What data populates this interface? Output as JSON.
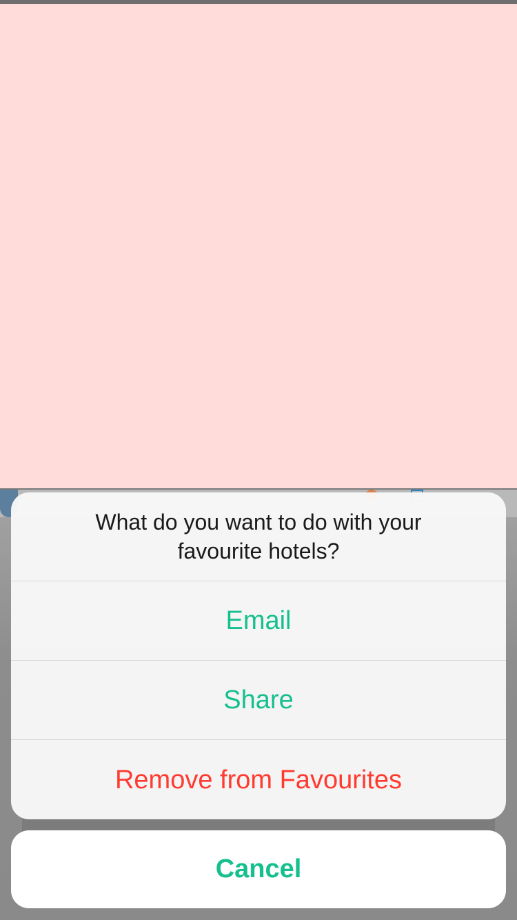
{
  "action_sheet": {
    "title": "What do you want to do with your favourite hotels?",
    "options": [
      {
        "label": "Email"
      },
      {
        "label": "Share"
      },
      {
        "label": "Remove from Favourites"
      }
    ]
  },
  "cancel_label": "Cancel",
  "colors": {
    "accent": "#16c08e",
    "destructive": "#ff3b30",
    "overlay_pink": "#ffdbd9"
  }
}
